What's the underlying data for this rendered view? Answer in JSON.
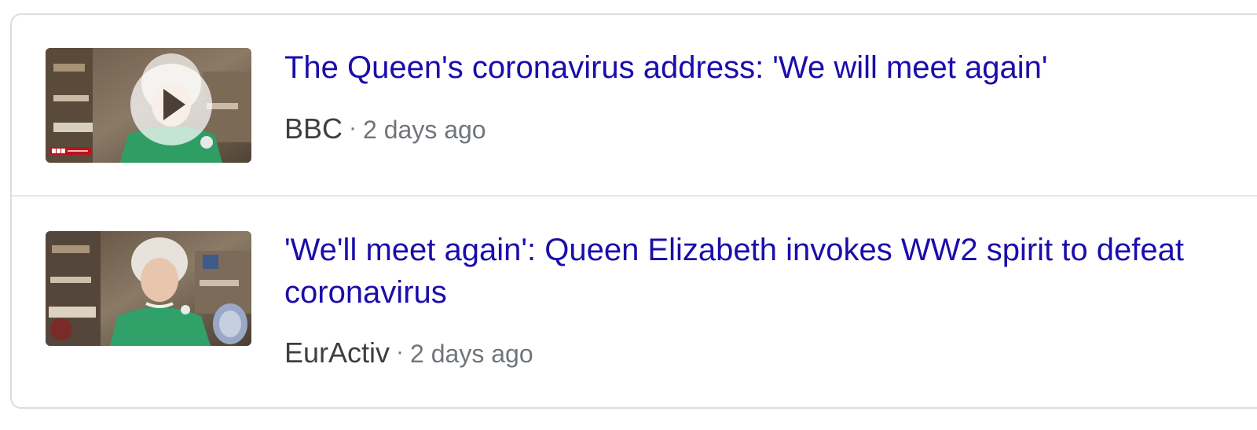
{
  "stories": [
    {
      "title": "The Queen's coronavirus address: 'We will meet again'",
      "source": "BBC",
      "separator": "·",
      "time": "2 days ago",
      "thumbnail": {
        "kind": "video",
        "play_icon": "play-icon",
        "channel_badge": "BBC NEWS"
      }
    },
    {
      "title": "'We'll meet again': Queen Elizabeth invokes WW2 spirit to defeat coronavirus",
      "source": "EurActiv",
      "separator": "·",
      "time": "2 days ago",
      "thumbnail": {
        "kind": "image"
      }
    }
  ],
  "colors": {
    "link": "#1a0dab",
    "source": "#3c4043",
    "meta": "#70757a",
    "border": "#dadce0"
  }
}
